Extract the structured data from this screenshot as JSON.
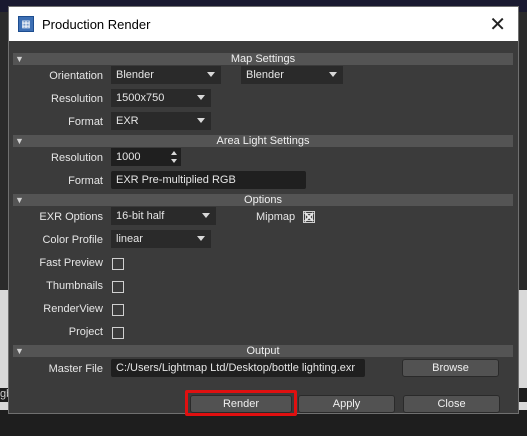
{
  "window": {
    "title": "Production Render",
    "close_glyph": "✕"
  },
  "background": {
    "left_text": "gb"
  },
  "sections": {
    "map_settings": "Map Settings",
    "area_light_settings": "Area Light Settings",
    "options": "Options",
    "output": "Output"
  },
  "map_settings": {
    "orientation_label": "Orientation",
    "orientation_value_1": "Blender",
    "orientation_value_2": "Blender",
    "resolution_label": "Resolution",
    "resolution_value": "1500x750",
    "format_label": "Format",
    "format_value": "EXR"
  },
  "area_light": {
    "resolution_label": "Resolution",
    "resolution_value": "1000",
    "format_label": "Format",
    "format_value": "EXR Pre-multiplied RGB"
  },
  "options": {
    "exr_options_label": "EXR Options",
    "exr_options_value": "16-bit half",
    "mipmap_label": "Mipmap",
    "mipmap_checked": true,
    "color_profile_label": "Color Profile",
    "color_profile_value": "linear",
    "fast_preview_label": "Fast Preview",
    "thumbnails_label": "Thumbnails",
    "renderview_label": "RenderView",
    "project_label": "Project"
  },
  "output": {
    "master_file_label": "Master File",
    "master_file_value": "C:/Users/Lightmap Ltd/Desktop/bottle lighting.exr",
    "browse_label": "Browse"
  },
  "buttons": {
    "render": "Render",
    "apply": "Apply",
    "close": "Close"
  },
  "colors": {
    "highlight": "#e01010",
    "section_header": "#545454",
    "panel": "#3b3b3b"
  }
}
